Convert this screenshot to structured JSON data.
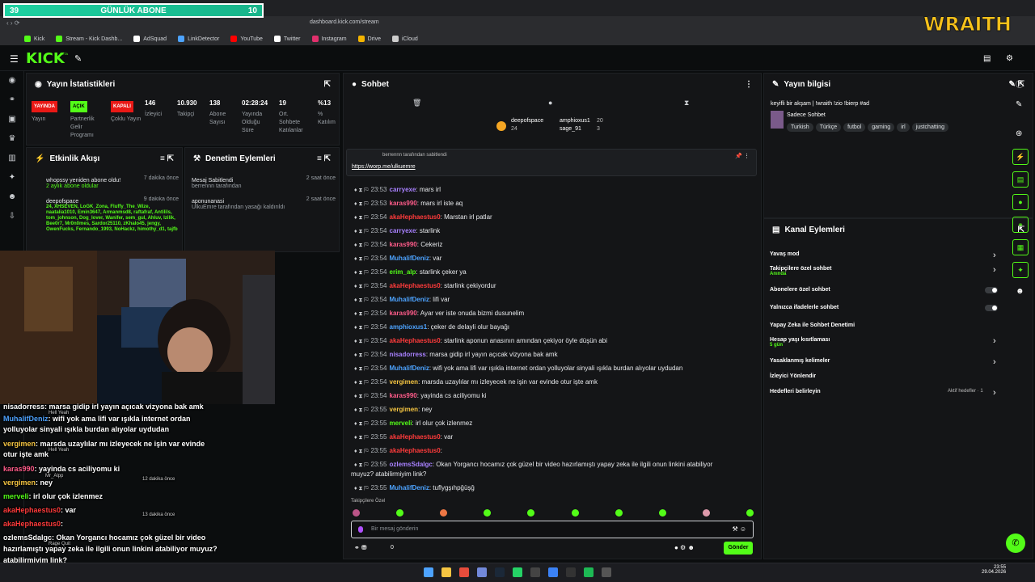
{
  "browser": {
    "url": "dashboard.kick.com/stream",
    "bookmarks": [
      "Kick",
      "Stream - Kick Dashb...",
      "AdSquad",
      "LinkDetector",
      "YouTube",
      "Twitter",
      "Instagram",
      "Drive",
      "iCloud"
    ]
  },
  "overlay": {
    "abone_left": "39",
    "abone_title": "GÜNLÜK ABONE",
    "abone_right": "10",
    "brand": "WRAITH"
  },
  "header": {
    "logo": "KICK",
    "beta": "BETA"
  },
  "stats": {
    "title": "Yayın İstatistikleri",
    "items": [
      {
        "value": "YAYINDA",
        "label": "Yayın"
      },
      {
        "value": "AÇIK",
        "label": "Partnerlik Gelir Programı"
      },
      {
        "value": "KAPALI",
        "label": "Çoklu Yayın"
      },
      {
        "value": "146",
        "label": "İzleyici"
      },
      {
        "value": "10.930",
        "label": "Takipçi"
      },
      {
        "value": "138",
        "label": "Abone Sayısı"
      },
      {
        "value": "02:28:24",
        "label": "Yayında Olduğu Süre"
      },
      {
        "value": "19",
        "label": "Ort. Sohbete Katılanlar"
      },
      {
        "value": "%13",
        "label": "% Katılım"
      }
    ]
  },
  "activity": {
    "title": "Etkinlik Akışı",
    "items": [
      {
        "name": "whopssy yeniden abone oldu!",
        "time": "7 dakika önce",
        "sub": "2 aylık abone oldular"
      },
      {
        "name": "deepofspace",
        "time": "9 dakika önce",
        "sub": "24, XHSEVEN, LoGK_Zona, Fluffy_The_Wize, naatalia1010, Emin3647, Armanmsd8, raftafraf, Antilils, tom_johnson, Dog_lover, Wanifer, sem_gul, Ahluv, Izilik, Bee0r7, Mr0n0mes, Sardor25110, zKhalo45, jengy, OwenFucks, Fernando_1993, NoHackz, himothy_d1, tajfb"
      }
    ]
  },
  "moderation": {
    "title": "Denetim Eylemleri",
    "items": [
      {
        "name": "Mesaj Sabitlendi",
        "time": "2 saat önce",
        "sub": "berrennn tarafından"
      },
      {
        "name": "aponunanasi",
        "time": "2 saat önce",
        "sub": "UlkuEmre tarafından yasağı kaldırıldı"
      }
    ]
  },
  "overlay_chat": [
    {
      "user": "nisadorress",
      "text": ": marsa gidip irl yayın açıcak vizyona bak amk",
      "color": "#ffffff"
    },
    {
      "user": "MuhalifDeniz",
      "text": ": wifi yok ama lifi var ışıkla internet ordan",
      "color": "#4da3ff"
    },
    {
      "user": "",
      "text": "yolluyolar sinyali ışıkla burdan alıyolar uydudan",
      "color": "#ffffff"
    },
    {
      "user": "vergimen",
      "text": ": marsda uzaylılar mı izleyecek ne işin var evinde",
      "color": "#f5c542"
    },
    {
      "user": "",
      "text": "otur işte amk",
      "color": "#ffffff"
    },
    {
      "user": "karas990",
      "text": ": yayinda cs aciliyomu ki",
      "color": "#ff5c8a"
    },
    {
      "user": "vergimen",
      "text": ": ney",
      "color": "#f5c542"
    },
    {
      "user": "merveli",
      "text": ": irl olur çok izlenmez",
      "color": "#53fc18"
    },
    {
      "user": "akaHephaestus0",
      "text": ": var",
      "color": "#ff3b3b"
    },
    {
      "user": "akaHephaestus0",
      "text": ":",
      "color": "#ff3b3b"
    },
    {
      "user": "ozlemsSdalgc",
      "text": ": Okan Yorgancı hocamız çok güzel bir video",
      "color": "#ffffff"
    },
    {
      "user": "",
      "text": "hazırlamıştı yapay zeka ile ilgili onun linkini atabiliyor muyuz?",
      "color": "#ffffff"
    },
    {
      "user": "",
      "text": "atabilirmiyim link?",
      "color": "#ffffff"
    },
    {
      "user": "MuhalifDeniz",
      "text": ": tuflygşıhpğüşğ",
      "color": "#4da3ff"
    }
  ],
  "overlay_alerts": [
    "Hell Yeah",
    "Hell Yeah",
    "Mr_Alpp",
    "12 dakika önce",
    "13 dakika önce",
    "Rage Quit"
  ],
  "chat": {
    "title": "Sohbet",
    "top_users": [
      {
        "name": "deepofspace",
        "count": "24"
      },
      {
        "name": "amphioxus1",
        "count": "20"
      },
      {
        "name": "sage_91",
        "count": "3"
      }
    ],
    "pinned_by": "berrennn tarafından sabitlendi",
    "pinned_link": "https://worp.me/ulkuemre",
    "messages": [
      {
        "time": "23:53",
        "user": "carryexe",
        "text": ": mars irl",
        "color": "#a881ff"
      },
      {
        "time": "23:53",
        "user": "karas990",
        "text": ": mars irl iste aq",
        "color": "#ff5c8a"
      },
      {
        "time": "23:54",
        "user": "akaHephaestus0",
        "text": ": Marstan irl patlar",
        "color": "#ff3b3b"
      },
      {
        "time": "23:54",
        "user": "carryexe",
        "text": ": starlink",
        "color": "#a881ff"
      },
      {
        "time": "23:54",
        "user": "karas990",
        "text": ": Cekeriz",
        "color": "#ff5c8a"
      },
      {
        "time": "23:54",
        "user": "MuhalifDeniz",
        "text": ": var",
        "color": "#4da3ff"
      },
      {
        "time": "23:54",
        "user": "erim_alp",
        "text": ": starlink çeker ya",
        "color": "#53fc18"
      },
      {
        "time": "23:54",
        "user": "akaHephaestus0",
        "text": ": starlink çekiyordur",
        "color": "#ff3b3b"
      },
      {
        "time": "23:54",
        "user": "MuhalifDeniz",
        "text": ": lifi var",
        "color": "#4da3ff"
      },
      {
        "time": "23:54",
        "user": "karas990",
        "text": ": Ayar ver iste onuda bizmi dusunelim",
        "color": "#ff5c8a"
      },
      {
        "time": "23:54",
        "user": "amphioxus1",
        "text": ": çeker de delayli olur bayağı",
        "color": "#4da3ff"
      },
      {
        "time": "23:54",
        "user": "akaHephaestus0",
        "text": ": starlink aponun anasının amından çekiyor öyle düşün abi",
        "color": "#ff3b3b"
      },
      {
        "time": "23:54",
        "user": "nisadorress",
        "text": ": marsa gidip irl yayın açıcak vizyona bak amk",
        "color": "#a881ff"
      },
      {
        "time": "23:54",
        "user": "MuhalifDeniz",
        "text": ": wifi yok ama lifi var ışıkla internet ordan yolluyolar sinyali ışıkla burdan alıyolar uydudan",
        "color": "#4da3ff"
      },
      {
        "time": "23:54",
        "user": "vergimen",
        "text": ": marsda uzaylılar mı izleyecek ne işin var evinde otur işte amk",
        "color": "#f5c542"
      },
      {
        "time": "23:54",
        "user": "karas990",
        "text": ": yayinda cs aciliyomu ki",
        "color": "#ff5c8a"
      },
      {
        "time": "23:55",
        "user": "vergimen",
        "text": ": ney",
        "color": "#f5c542"
      },
      {
        "time": "23:55",
        "user": "merveli",
        "text": ": irl olur çok izlenmez",
        "color": "#53fc18"
      },
      {
        "time": "23:55",
        "user": "akaHephaestus0",
        "text": ": var",
        "color": "#ff3b3b"
      },
      {
        "time": "23:55",
        "user": "akaHephaestus0",
        "text": ":",
        "color": "#ff3b3b"
      },
      {
        "time": "23:55",
        "user": "ozlemsSdalgc",
        "text": ": Okan Yorgancı hocamız çok güzel bir video hazırlamıştı yapay zeka ile ilgili onun linkini atabiliyor",
        "color": "#a881ff"
      },
      {
        "time": "",
        "user": "",
        "text": "muyuz? atabilirmiyim link?",
        "color": "#ffffff"
      },
      {
        "time": "23:55",
        "user": "MuhalifDeniz",
        "text": ": tuflygşıhpğüşğ",
        "color": "#4da3ff"
      }
    ],
    "followers_only": "Takipçilere Özel",
    "input_placeholder": "Bir mesaj gönderin",
    "count": "0",
    "send": "Gönder"
  },
  "stream_info": {
    "title": "Yayın bilgisi",
    "stream_title": "keyifli bir akşam | !wraith !zio !bierp #ad",
    "category": "Sadece Sohbet",
    "tags": [
      "Turkish",
      "Türkçe",
      "futbol",
      "gaming",
      "irl",
      "justchatting"
    ]
  },
  "channel_actions": {
    "title": "Kanal Eylemleri",
    "rows": [
      {
        "label": "Yavaş mod",
        "sub": ""
      },
      {
        "label": "Takipçilere özel sohbet",
        "sub": "Anında"
      },
      {
        "label": "Abonelere özel sohbet",
        "sub": ""
      },
      {
        "label": "Yalnızca ifadelerle sohbet",
        "sub": ""
      },
      {
        "label": "Yapay Zeka ile Sohbet Denetimi",
        "sub": ""
      },
      {
        "label": "Hesap yaşı kısıtlaması",
        "sub": "5 gün"
      },
      {
        "label": "Yasaklanmış kelimeler",
        "sub": ""
      },
      {
        "label": "İzleyici Yönlendir",
        "sub": ""
      },
      {
        "label": "Hedefleri belirleyin",
        "sub": ""
      }
    ],
    "goal_status": "Aktif hedefler · 1"
  },
  "taskbar": {
    "time": "23:55",
    "date": "29.04.2026"
  }
}
